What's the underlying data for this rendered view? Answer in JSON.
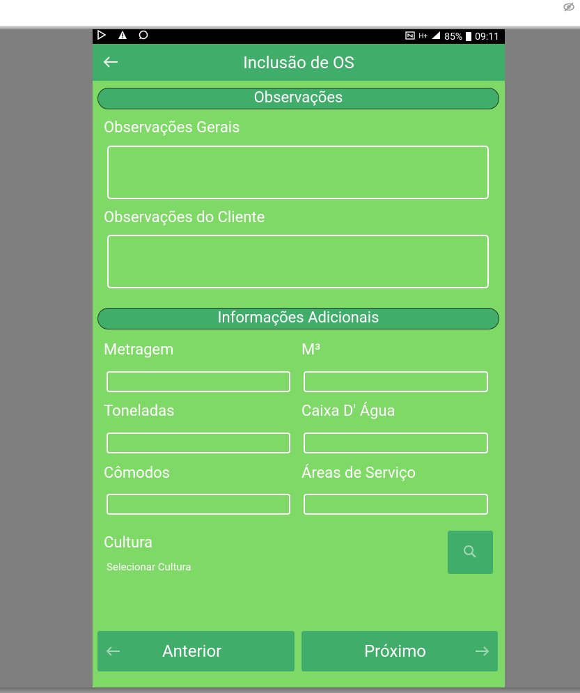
{
  "status_bar": {
    "signal_text": "85%",
    "time": "09:11"
  },
  "app_bar": {
    "title": "Inclusão de OS"
  },
  "sections": {
    "observacoes": "Observações",
    "informacoes": "Informações Adicionais"
  },
  "fields": {
    "obs_gerais": {
      "label": "Observações Gerais",
      "value": ""
    },
    "obs_cliente": {
      "label": "Observações do Cliente",
      "value": ""
    },
    "metragem": {
      "label": "Metragem",
      "value": ""
    },
    "m3": {
      "label": "M³",
      "value": ""
    },
    "toneladas": {
      "label": "Toneladas",
      "value": ""
    },
    "caixa_agua": {
      "label": "Caixa D' Água",
      "value": ""
    },
    "comodos": {
      "label": "Cômodos",
      "value": ""
    },
    "areas_servico": {
      "label": "Áreas de Serviço",
      "value": ""
    }
  },
  "cultura": {
    "label": "Cultura",
    "placeholder": "Selecionar Cultura"
  },
  "navigation": {
    "prev_label": "Anterior",
    "next_label": "Próximo"
  },
  "icons": {
    "back": "arrow-left-icon",
    "search": "search-icon",
    "prev": "arrow-left-icon",
    "next": "arrow-right-icon"
  },
  "colors": {
    "background": "#7fd967",
    "accent": "#41ad6a",
    "text": "#ffffff"
  }
}
